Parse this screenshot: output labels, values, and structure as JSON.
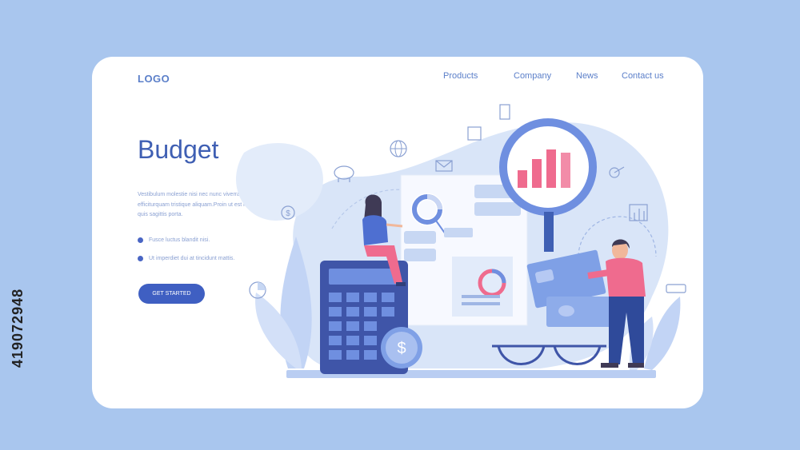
{
  "header": {
    "logo": "LOGO",
    "nav": [
      "Products",
      "Company",
      "News",
      "Contact us"
    ]
  },
  "hero": {
    "title": "Budget",
    "description": "Vestibulum molestie nisi nec nunc viverra efficitur, efficiturquam tristique aliquam.Proin ut est lectus. risus quis sagittis porta.",
    "bullets": [
      "Fusce luctus blandit nisi.",
      "Ut imperdiet dui at tincidunt mattis."
    ],
    "cta_label": "GET STARTED"
  },
  "illustration": {
    "coin_symbol": "$",
    "icons": [
      "globe-icon",
      "mail-icon",
      "piggy-bank-icon",
      "dollar-icon",
      "pie-chart-icon",
      "target-icon",
      "bar-chart-icon",
      "magnifier-icon",
      "calculator-icon",
      "glasses-icon",
      "banknote-icon"
    ]
  },
  "watermark": "419072948",
  "colors": {
    "background": "#a9c6ee",
    "primary": "#3f5fc2",
    "accent_pink": "#ef6b8e",
    "text_blue": "#5b7fc9"
  }
}
